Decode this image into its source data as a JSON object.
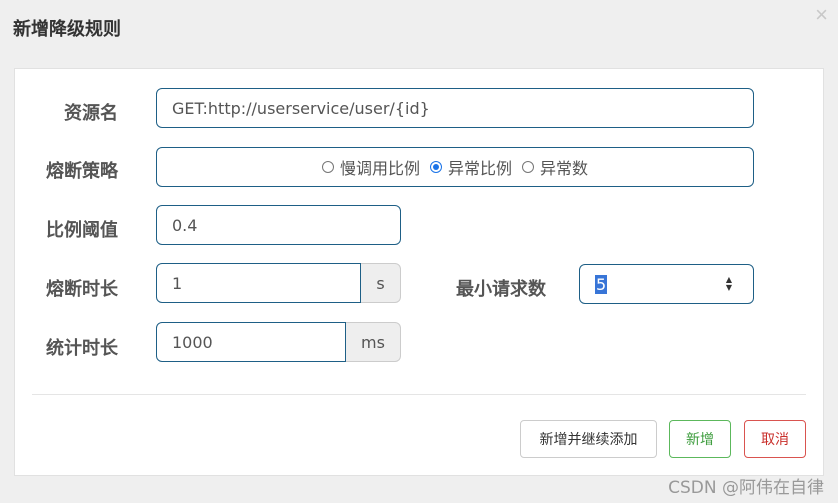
{
  "dialog": {
    "title": "新增降级规则",
    "close_symbol": "×"
  },
  "form": {
    "resource": {
      "label": "资源名",
      "value": "GET:http://userservice/user/{id}"
    },
    "strategy": {
      "label": "熔断策略",
      "options": [
        {
          "label": "慢调用比例",
          "checked": false
        },
        {
          "label": "异常比例",
          "checked": true
        },
        {
          "label": "异常数",
          "checked": false
        }
      ]
    },
    "ratio": {
      "label": "比例阈值",
      "value": "0.4"
    },
    "duration": {
      "label": "熔断时长",
      "value": "1",
      "unit": "s"
    },
    "min_requests": {
      "label": "最小请求数",
      "value": "5"
    },
    "stat_duration": {
      "label": "统计时长",
      "value": "1000",
      "unit": "ms"
    }
  },
  "buttons": {
    "add_continue": "新增并继续添加",
    "add": "新增",
    "cancel": "取消"
  },
  "watermark": "CSDN @阿伟在自律",
  "colors": {
    "input_border": "#1e5f86",
    "radio_checked": "#1a73e8",
    "success": "#5cb85c",
    "danger": "#d9534f",
    "selection": "#3875d7"
  }
}
